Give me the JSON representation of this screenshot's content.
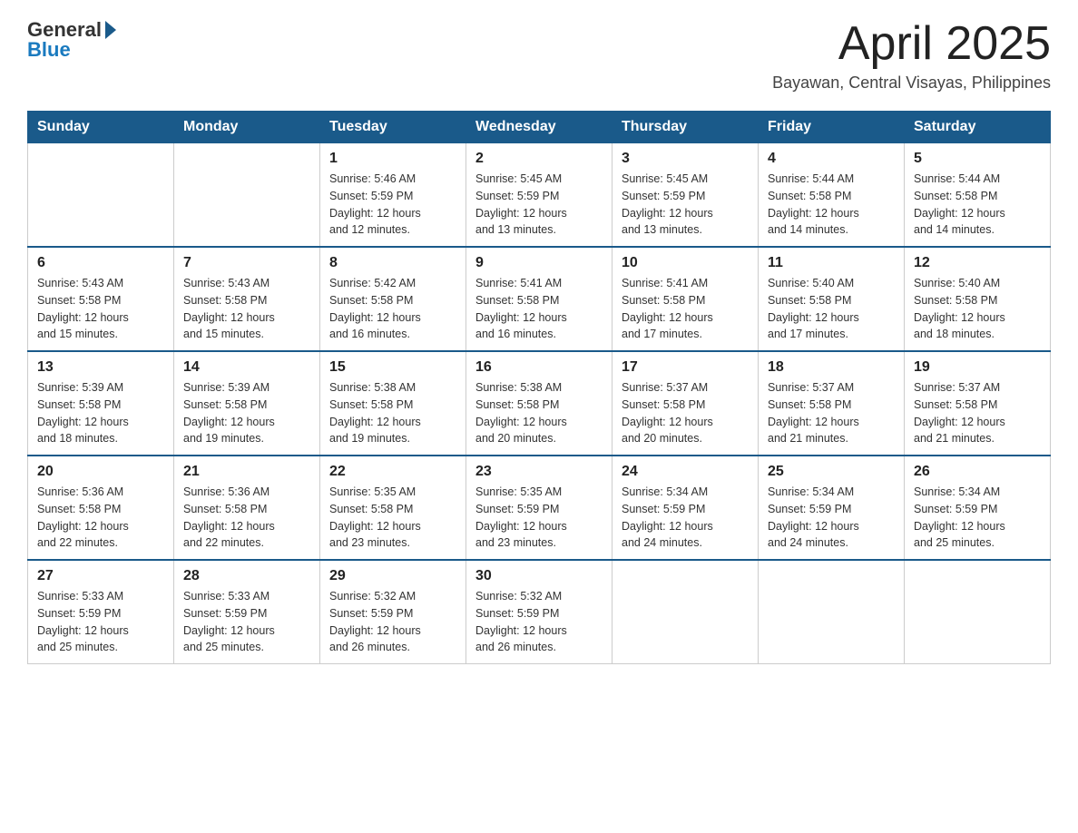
{
  "header": {
    "logo_text": "General",
    "logo_blue": "Blue",
    "month": "April 2025",
    "location": "Bayawan, Central Visayas, Philippines"
  },
  "days_of_week": [
    "Sunday",
    "Monday",
    "Tuesday",
    "Wednesday",
    "Thursday",
    "Friday",
    "Saturday"
  ],
  "weeks": [
    [
      {
        "day": "",
        "info": ""
      },
      {
        "day": "",
        "info": ""
      },
      {
        "day": "1",
        "info": "Sunrise: 5:46 AM\nSunset: 5:59 PM\nDaylight: 12 hours\nand 12 minutes."
      },
      {
        "day": "2",
        "info": "Sunrise: 5:45 AM\nSunset: 5:59 PM\nDaylight: 12 hours\nand 13 minutes."
      },
      {
        "day": "3",
        "info": "Sunrise: 5:45 AM\nSunset: 5:59 PM\nDaylight: 12 hours\nand 13 minutes."
      },
      {
        "day": "4",
        "info": "Sunrise: 5:44 AM\nSunset: 5:58 PM\nDaylight: 12 hours\nand 14 minutes."
      },
      {
        "day": "5",
        "info": "Sunrise: 5:44 AM\nSunset: 5:58 PM\nDaylight: 12 hours\nand 14 minutes."
      }
    ],
    [
      {
        "day": "6",
        "info": "Sunrise: 5:43 AM\nSunset: 5:58 PM\nDaylight: 12 hours\nand 15 minutes."
      },
      {
        "day": "7",
        "info": "Sunrise: 5:43 AM\nSunset: 5:58 PM\nDaylight: 12 hours\nand 15 minutes."
      },
      {
        "day": "8",
        "info": "Sunrise: 5:42 AM\nSunset: 5:58 PM\nDaylight: 12 hours\nand 16 minutes."
      },
      {
        "day": "9",
        "info": "Sunrise: 5:41 AM\nSunset: 5:58 PM\nDaylight: 12 hours\nand 16 minutes."
      },
      {
        "day": "10",
        "info": "Sunrise: 5:41 AM\nSunset: 5:58 PM\nDaylight: 12 hours\nand 17 minutes."
      },
      {
        "day": "11",
        "info": "Sunrise: 5:40 AM\nSunset: 5:58 PM\nDaylight: 12 hours\nand 17 minutes."
      },
      {
        "day": "12",
        "info": "Sunrise: 5:40 AM\nSunset: 5:58 PM\nDaylight: 12 hours\nand 18 minutes."
      }
    ],
    [
      {
        "day": "13",
        "info": "Sunrise: 5:39 AM\nSunset: 5:58 PM\nDaylight: 12 hours\nand 18 minutes."
      },
      {
        "day": "14",
        "info": "Sunrise: 5:39 AM\nSunset: 5:58 PM\nDaylight: 12 hours\nand 19 minutes."
      },
      {
        "day": "15",
        "info": "Sunrise: 5:38 AM\nSunset: 5:58 PM\nDaylight: 12 hours\nand 19 minutes."
      },
      {
        "day": "16",
        "info": "Sunrise: 5:38 AM\nSunset: 5:58 PM\nDaylight: 12 hours\nand 20 minutes."
      },
      {
        "day": "17",
        "info": "Sunrise: 5:37 AM\nSunset: 5:58 PM\nDaylight: 12 hours\nand 20 minutes."
      },
      {
        "day": "18",
        "info": "Sunrise: 5:37 AM\nSunset: 5:58 PM\nDaylight: 12 hours\nand 21 minutes."
      },
      {
        "day": "19",
        "info": "Sunrise: 5:37 AM\nSunset: 5:58 PM\nDaylight: 12 hours\nand 21 minutes."
      }
    ],
    [
      {
        "day": "20",
        "info": "Sunrise: 5:36 AM\nSunset: 5:58 PM\nDaylight: 12 hours\nand 22 minutes."
      },
      {
        "day": "21",
        "info": "Sunrise: 5:36 AM\nSunset: 5:58 PM\nDaylight: 12 hours\nand 22 minutes."
      },
      {
        "day": "22",
        "info": "Sunrise: 5:35 AM\nSunset: 5:58 PM\nDaylight: 12 hours\nand 23 minutes."
      },
      {
        "day": "23",
        "info": "Sunrise: 5:35 AM\nSunset: 5:59 PM\nDaylight: 12 hours\nand 23 minutes."
      },
      {
        "day": "24",
        "info": "Sunrise: 5:34 AM\nSunset: 5:59 PM\nDaylight: 12 hours\nand 24 minutes."
      },
      {
        "day": "25",
        "info": "Sunrise: 5:34 AM\nSunset: 5:59 PM\nDaylight: 12 hours\nand 24 minutes."
      },
      {
        "day": "26",
        "info": "Sunrise: 5:34 AM\nSunset: 5:59 PM\nDaylight: 12 hours\nand 25 minutes."
      }
    ],
    [
      {
        "day": "27",
        "info": "Sunrise: 5:33 AM\nSunset: 5:59 PM\nDaylight: 12 hours\nand 25 minutes."
      },
      {
        "day": "28",
        "info": "Sunrise: 5:33 AM\nSunset: 5:59 PM\nDaylight: 12 hours\nand 25 minutes."
      },
      {
        "day": "29",
        "info": "Sunrise: 5:32 AM\nSunset: 5:59 PM\nDaylight: 12 hours\nand 26 minutes."
      },
      {
        "day": "30",
        "info": "Sunrise: 5:32 AM\nSunset: 5:59 PM\nDaylight: 12 hours\nand 26 minutes."
      },
      {
        "day": "",
        "info": ""
      },
      {
        "day": "",
        "info": ""
      },
      {
        "day": "",
        "info": ""
      }
    ]
  ]
}
